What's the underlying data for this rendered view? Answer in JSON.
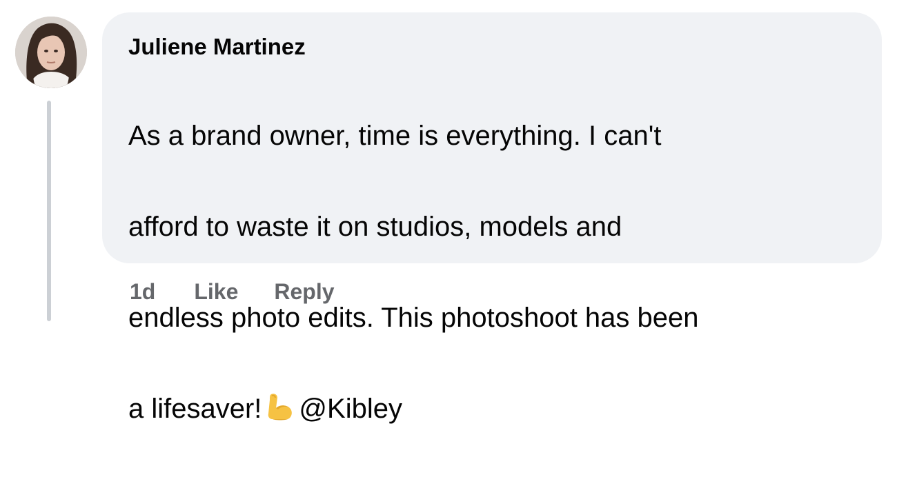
{
  "comment": {
    "author": "Juliene Martinez",
    "text_lines": [
      "As a brand owner, time is everything. I can't",
      "afford to waste it on studios, models and",
      "endless photo edits. This photoshoot has been",
      "a lifesaver!"
    ],
    "emoji": "flexed-biceps-emoji",
    "mention": "@Kibley",
    "actions": {
      "time": "1d",
      "like_label": "Like",
      "reply_label": "Reply"
    }
  },
  "colors": {
    "bubble_background": "#f0f2f5",
    "text": "#050505",
    "secondary_text": "#65676b",
    "thread_line": "#ccd0d5"
  }
}
